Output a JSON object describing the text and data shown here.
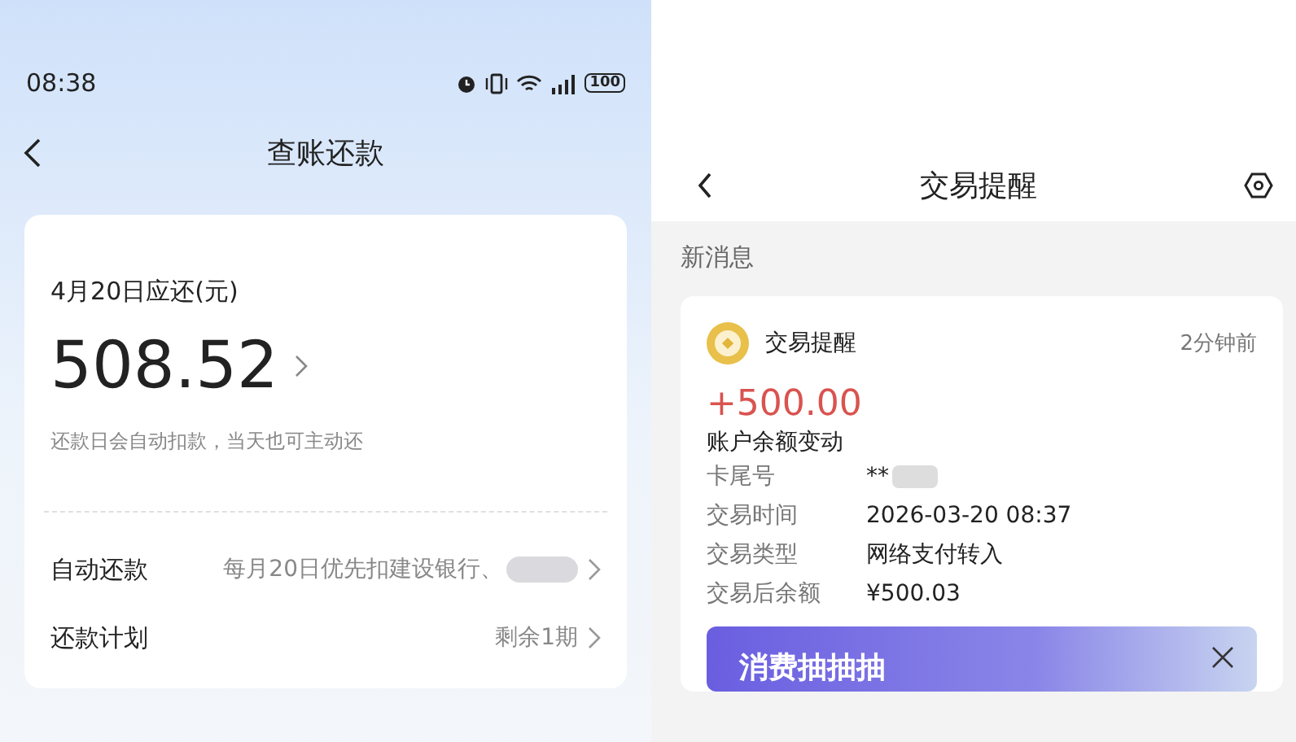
{
  "left_screen": {
    "status_bar": {
      "time": "08:38",
      "battery": "100"
    },
    "title": "查账还款",
    "bill": {
      "due_label": "4月20日应还(元)",
      "amount": "508.52",
      "note": "还款日会自动扣款，当天也可主动还"
    },
    "rows": [
      {
        "label": "自动还款",
        "value": "每月20日优先扣建设银行、",
        "redacted": true
      },
      {
        "label": "还款计划",
        "value": "剩余1期",
        "redacted": false
      }
    ]
  },
  "right_screen": {
    "title": "交易提醒",
    "section": "新消息",
    "message": {
      "sender": "交易提醒",
      "time": "2分钟前",
      "amount": "+500.00",
      "subtitle": "账户余额变动",
      "details": [
        {
          "label": "卡尾号",
          "value": "**",
          "redacted": true
        },
        {
          "label": "交易时间",
          "value": "2026-03-20 08:37",
          "redacted": false
        },
        {
          "label": "交易类型",
          "value": "网络支付转入",
          "redacted": false
        },
        {
          "label": "交易后余额",
          "value": "¥500.03",
          "redacted": false
        }
      ],
      "banner": {
        "text": "消费抽抽抽"
      }
    }
  }
}
